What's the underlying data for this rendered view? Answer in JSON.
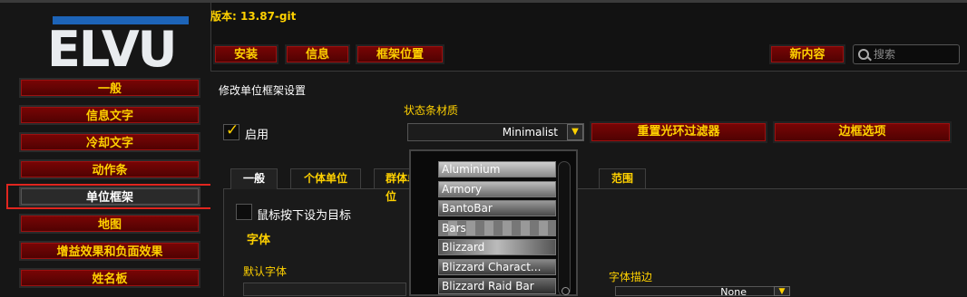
{
  "version_text": "版本: 13.87-git",
  "logo_text": "ELVU",
  "nav": {
    "items": [
      {
        "label": "一般"
      },
      {
        "label": "信息文字"
      },
      {
        "label": "冷却文字"
      },
      {
        "label": "动作条"
      },
      {
        "label": "单位框架"
      },
      {
        "label": "地图"
      },
      {
        "label": "增益效果和负面效果"
      },
      {
        "label": "姓名板"
      }
    ],
    "selected": "单位框架"
  },
  "toolbar": {
    "install": "安装",
    "info": "信息",
    "frame_position": "框架位置",
    "whats_new": "新内容",
    "search_placeholder": "搜索"
  },
  "panel": {
    "title": "修改单位框架设置",
    "enable_label": "启用",
    "enable_checked": true,
    "statusbar_label": "状态条材质",
    "statusbar_value": "Minimalist",
    "reset_aura_filter": "重置光环过滤器",
    "border_options": "边框选项"
  },
  "tabs": [
    {
      "label": "一般",
      "active": true
    },
    {
      "label": "个体单位"
    },
    {
      "label": "群体单位"
    },
    {
      "label": "范围"
    }
  ],
  "general": {
    "mouse_target_label": "鼠标按下设为目标",
    "font_section": "字体",
    "default_font": "默认字体",
    "font_outline": "字体描边",
    "font_outline_value": "None"
  },
  "statusbar_options": [
    "Aluminium",
    "Armory",
    "BantoBar",
    "Bars",
    "Blizzard",
    "Blizzard Charact...",
    "Blizzard Raid Bar"
  ],
  "colors": {
    "accent_gold": "#ffd100",
    "button_red": "#6a0404",
    "highlight_red": "#e0261f",
    "logo_blue": "#1d64b8"
  }
}
